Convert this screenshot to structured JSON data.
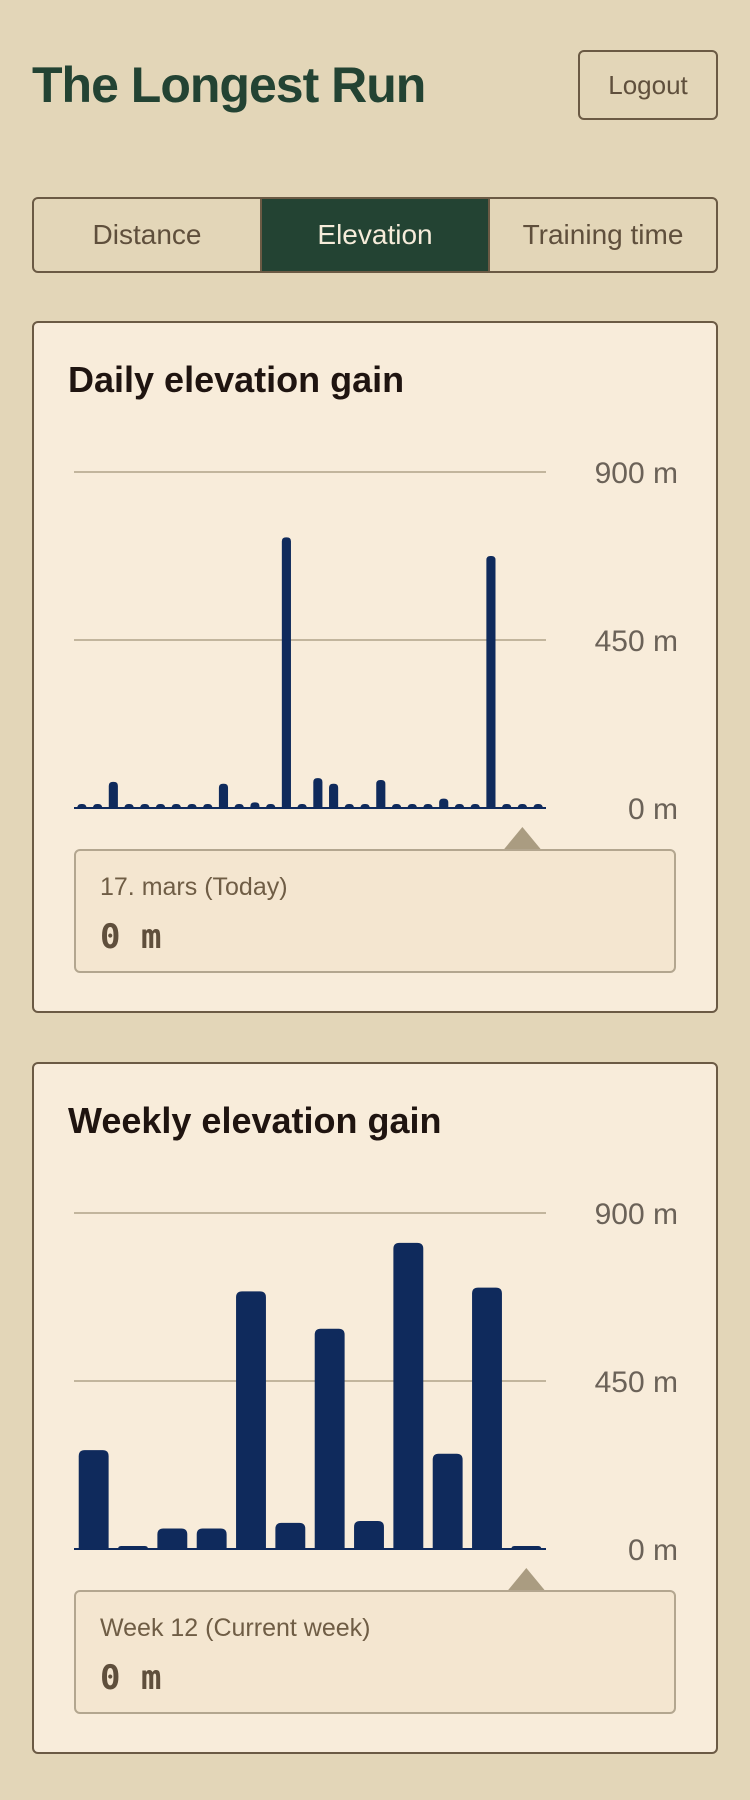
{
  "app": {
    "title": "The Longest Run",
    "logout_label": "Logout"
  },
  "tabs": [
    {
      "label": "Distance",
      "active": false
    },
    {
      "label": "Elevation",
      "active": true
    },
    {
      "label": "Training time",
      "active": false
    }
  ],
  "colors": {
    "background": "#e3d6b8",
    "brand": "#234333",
    "bar": "#0f2a5c",
    "card": "#f8ecda"
  },
  "daily": {
    "title": "Daily elevation gain",
    "tooltip": {
      "label": "17. mars (Today)",
      "value": "0 m"
    },
    "chart_data": {
      "type": "bar",
      "title": "Daily elevation gain",
      "ylim": [
        0,
        900
      ],
      "yticks": [
        "900 m",
        "450 m",
        "0 m"
      ],
      "ytick_values": [
        900,
        450,
        0
      ],
      "grid": true,
      "values": [
        0,
        0,
        70,
        0,
        0,
        0,
        0,
        0,
        0,
        65,
        0,
        15,
        0,
        725,
        10,
        80,
        65,
        0,
        0,
        75,
        0,
        0,
        0,
        25,
        0,
        0,
        675,
        0,
        0,
        0
      ],
      "selected_index": 28
    }
  },
  "weekly": {
    "title": "Weekly elevation gain",
    "tooltip": {
      "label": "Week 12 (Current week)",
      "value": "0 m"
    },
    "chart_data": {
      "type": "bar",
      "title": "Weekly elevation gain",
      "ylim": [
        0,
        900
      ],
      "yticks": [
        "900 m",
        "450 m",
        "0 m"
      ],
      "ytick_values": [
        900,
        450,
        0
      ],
      "grid": true,
      "values": [
        265,
        5,
        55,
        55,
        690,
        70,
        590,
        75,
        820,
        255,
        700,
        5
      ],
      "selected_index": 11
    }
  }
}
